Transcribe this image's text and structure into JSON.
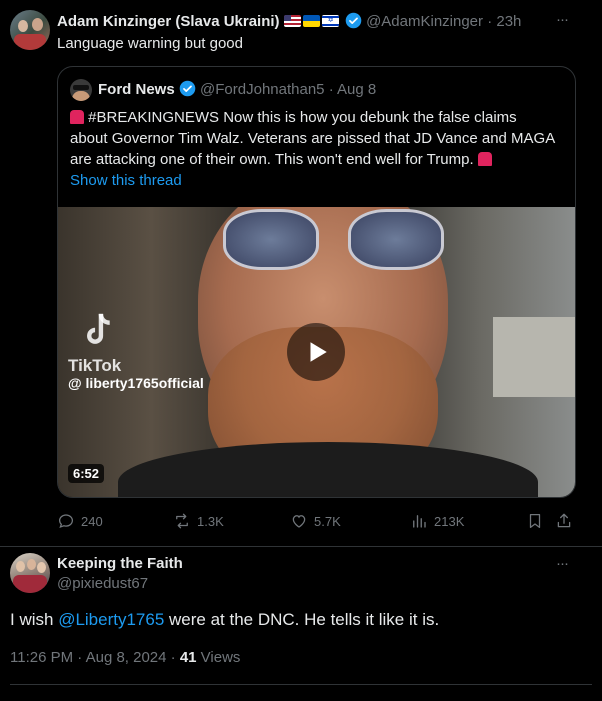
{
  "tweet": {
    "author_name": "Adam Kinzinger (Slava Ukraini)",
    "handle": "@AdamKinzinger",
    "separator": "·",
    "time": "23h",
    "more": "···",
    "text": "Language warning but good"
  },
  "quote": {
    "author_name": "Ford News",
    "handle": "@FordJohnathan5",
    "separator": "·",
    "date": "Aug 8",
    "text_line1": " #BREAKINGNEWS Now this is how you debunk the false claims",
    "text_line2": "about Governor Tim Walz. Veterans are pissed that JD Vance and MAGA",
    "text_line3": "are attacking one of their own. This won't end well for Trump. ",
    "show_thread": "Show this thread",
    "video": {
      "watermark_brand": "TikTok",
      "watermark_handle": "@ liberty1765official",
      "duration": "6:52"
    }
  },
  "actions": {
    "replies": "240",
    "reposts": "1.3K",
    "likes": "5.7K",
    "views": "213K"
  },
  "reply": {
    "author_name": "Keeping the Faith",
    "handle": "@pixiedust67",
    "more": "···",
    "text_before": "I wish ",
    "mention": "@Liberty1765",
    "text_after": " were at the DNC.  He tells it like it is.",
    "timestamp": "11:26 PM · Aug 8, 2024 · ",
    "view_count": "41",
    "views_label": " Views"
  },
  "colors": {
    "accent": "#1d9bf0",
    "muted": "#71767b",
    "background": "#000000"
  }
}
